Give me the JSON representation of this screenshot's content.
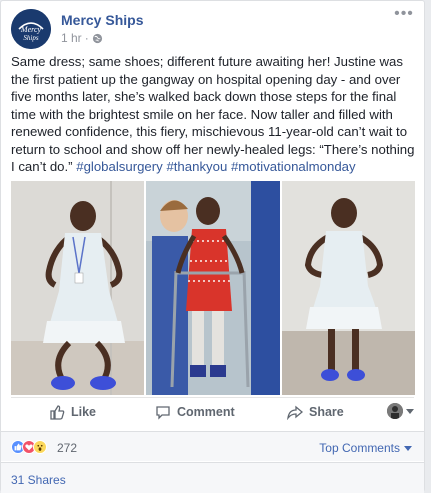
{
  "post": {
    "page_name": "Mercy Ships",
    "avatar_text": "Mercy Ships",
    "timestamp": "1 hr",
    "separator": "·",
    "body": "Same dress; same shoes; different future awaiting her! Justine was the first patient up the gangway on hospital opening day - and over five months later, she’s walked back down those steps for the final time with the brightest smile on her face. Now taller and filled with renewed confidence, this fiery, mischievous 11-year-old can’t wait to return to school and show off her newly-healed legs: “There’s nothing I can’t do.”",
    "hashtags": [
      "#globalsurgery",
      "#thankyou",
      "#motivationalmonday"
    ],
    "more_menu": "•••"
  },
  "actions": {
    "like_label": "Like",
    "comment_label": "Comment",
    "share_label": "Share"
  },
  "reactions": {
    "count": "272",
    "icons": [
      "like-reaction",
      "love-reaction",
      "wow-reaction"
    ],
    "colors": {
      "like": "#5890ff",
      "love": "#f25268",
      "wow": "#fcd85b"
    }
  },
  "comments_sort": {
    "label": "Top Comments"
  },
  "shares": {
    "label": "31 Shares"
  },
  "colors": {
    "link_blue": "#365899",
    "accent_blue": "#4267b2",
    "meta_gray": "#90949c"
  }
}
